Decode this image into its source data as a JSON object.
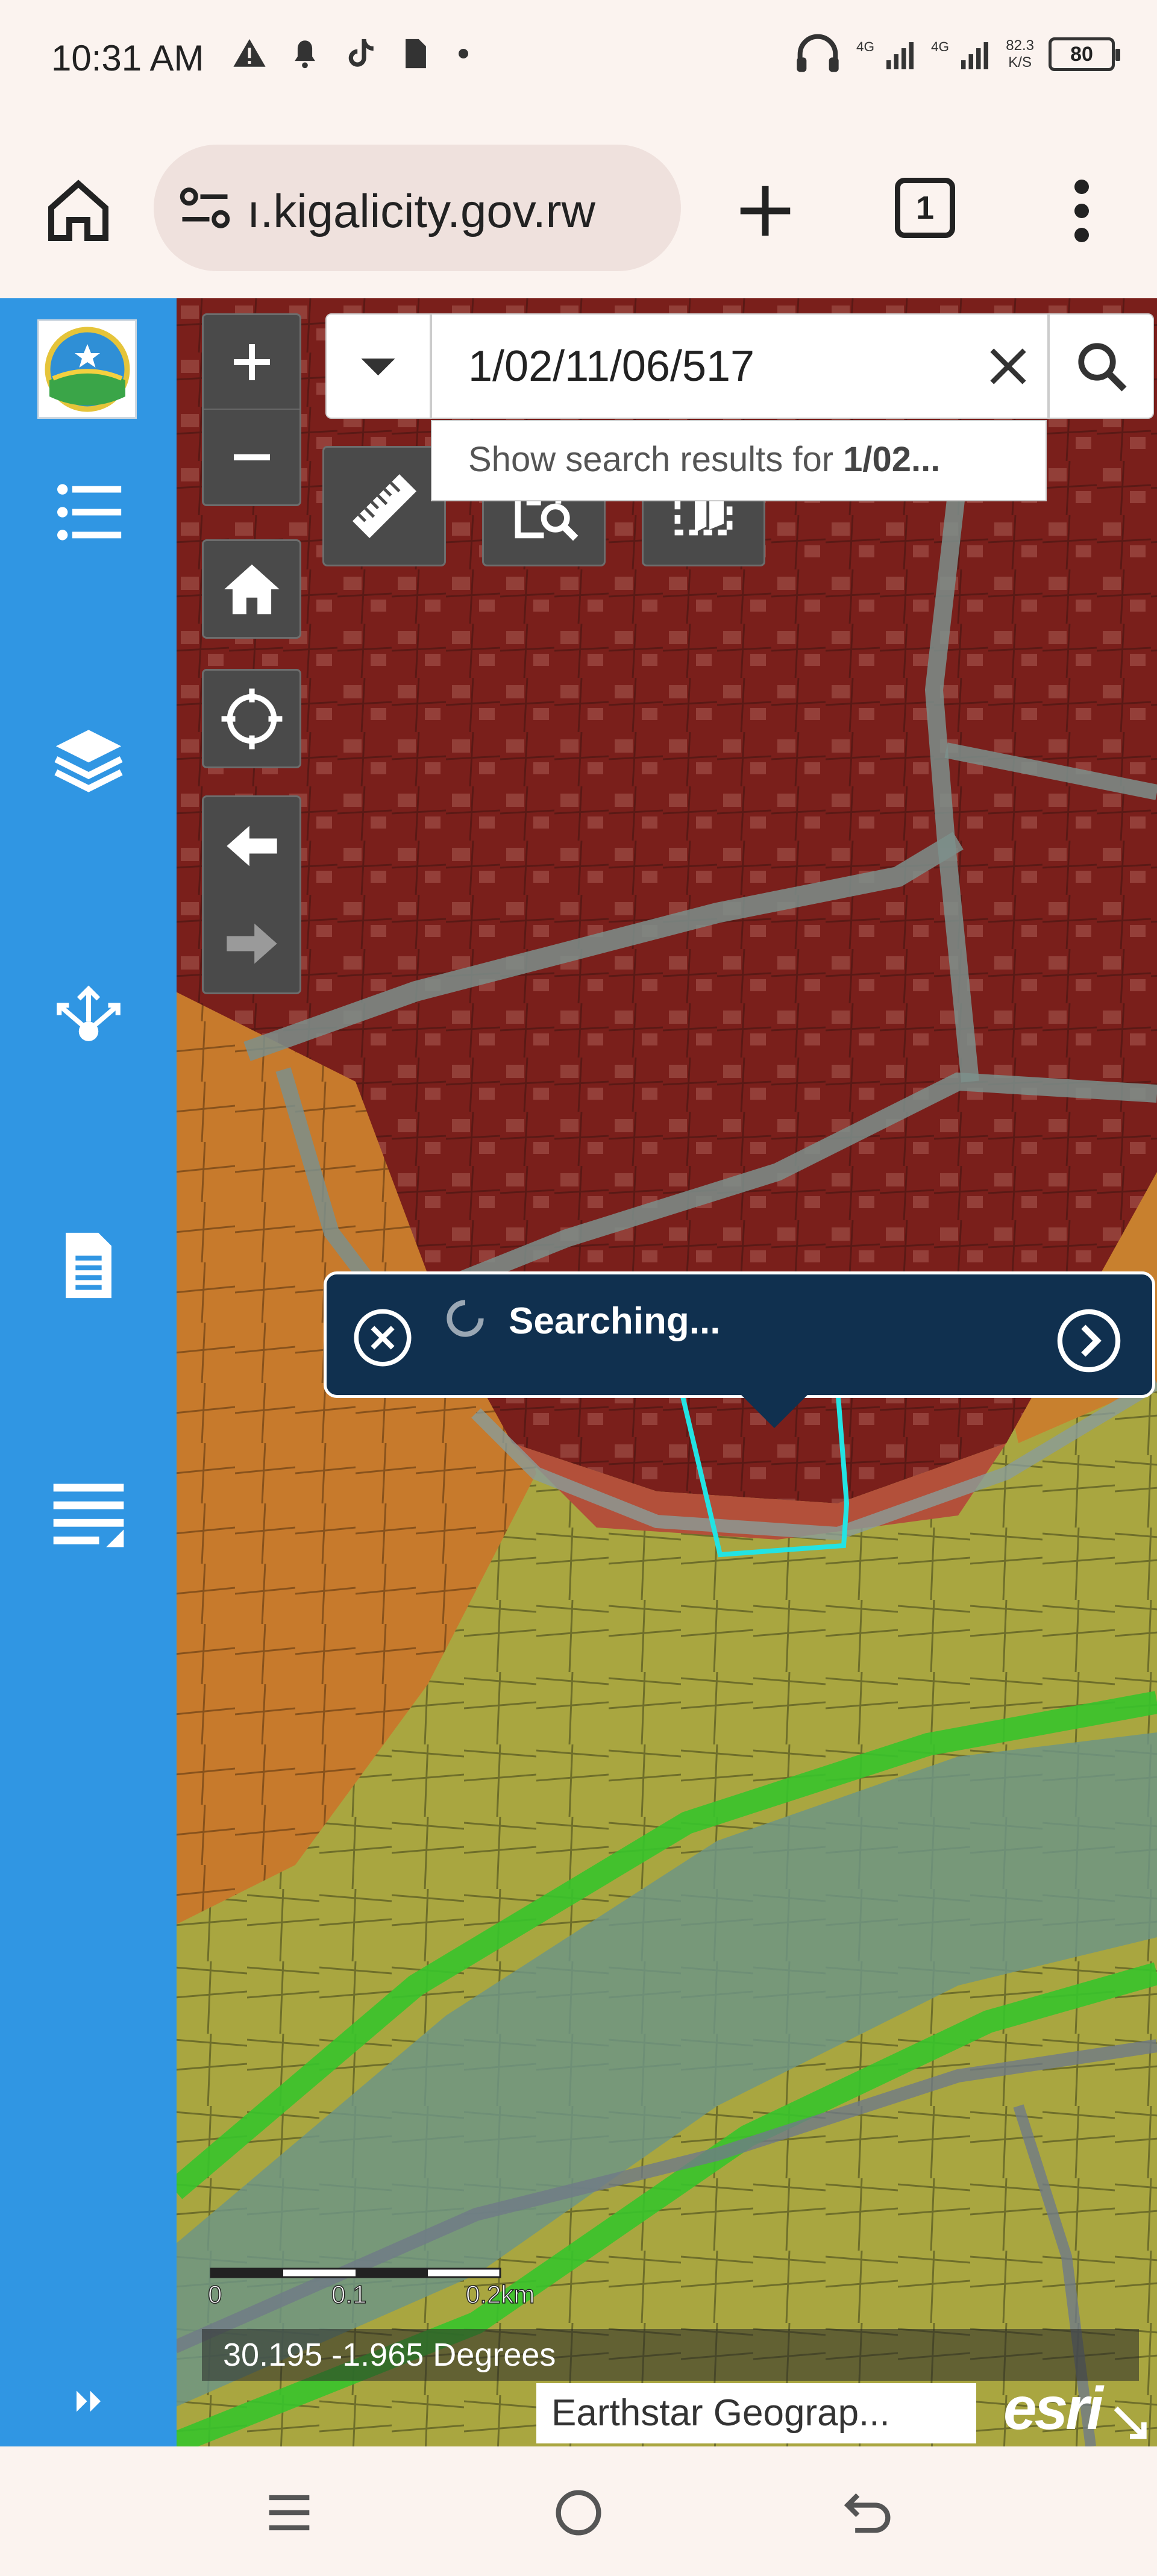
{
  "status_bar": {
    "time": "10:31 AM",
    "net_speed": "82.3",
    "net_speed_unit": "K/S",
    "battery": "80",
    "signal_1": "4G",
    "signal_2": "4G"
  },
  "browser": {
    "url": "ı.kigalicity.gov.rw",
    "tab_count": "1"
  },
  "search": {
    "value": "1/02/11/06/517",
    "suggestion_prefix": "Show search results for ",
    "suggestion_term": "1/02..."
  },
  "popup": {
    "text": "Searching..."
  },
  "scale": {
    "label_0": "0",
    "label_1": "0.1",
    "label_2": "0.2km"
  },
  "coordinates": "30.195 -1.965 Degrees",
  "attribution": "Earthstar Geograp...",
  "esri_logo": "esri",
  "sidebar": {
    "items": [
      "legend-icon",
      "layers-icon",
      "share-icon",
      "document-icon",
      "list-edit-icon",
      "expand-arrows-icon"
    ]
  },
  "colors": {
    "sidebar": "#3096e3",
    "popup_bg": "#10304f",
    "parcel_highlight": "#23e3e3"
  }
}
